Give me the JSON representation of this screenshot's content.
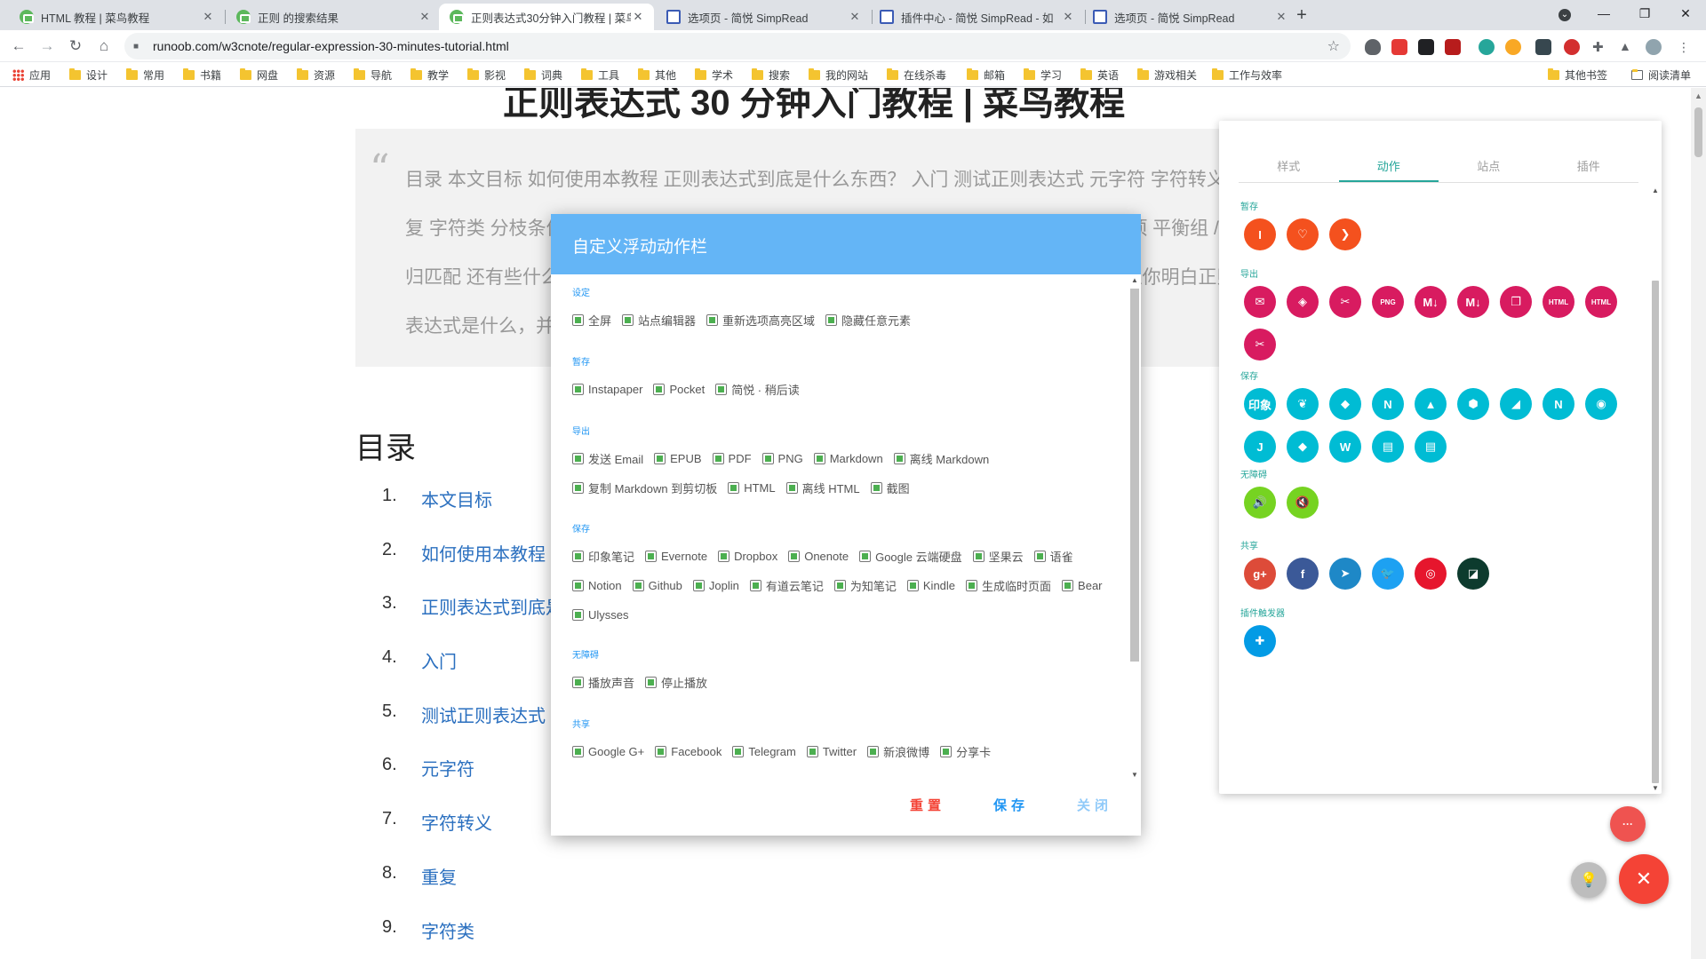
{
  "browser": {
    "tabs": [
      {
        "title": "HTML 教程 | 菜鸟教程",
        "favicon": "runoob-icon"
      },
      {
        "title": "正则 的搜索结果",
        "favicon": "runoob-icon"
      },
      {
        "title": "正则表达式30分钟入门教程 | 菜鸟",
        "favicon": "runoob-icon",
        "active": true
      },
      {
        "title": "选项页 - 简悦 SimpRead",
        "favicon": "simpread-icon"
      },
      {
        "title": "插件中心 - 简悦 SimpRead - 如",
        "favicon": "simpread-icon"
      },
      {
        "title": "选项页 - 简悦 SimpRead",
        "favicon": "simpread-icon"
      }
    ],
    "tab_close": "✕",
    "new_tab": "+",
    "window_controls": {
      "menu": "⌄",
      "minimize": "—",
      "restore": "❐",
      "close": "✕"
    },
    "url": "runoob.com/w3cnote/regular-expression-30-minutes-tutorial.html",
    "nav": {
      "back": "←",
      "forward": "→",
      "reload": "↻",
      "home": "⌂"
    },
    "bookmarks_left": [
      "应用",
      "设计",
      "常用",
      "书籍",
      "网盘",
      "资源",
      "导航",
      "教学",
      "影视",
      "词典",
      "工具",
      "其他",
      "学术",
      "搜索",
      "我的网站",
      "在线杀毒",
      "邮箱",
      "学习",
      "英语",
      "游戏相关",
      "工作与效率"
    ],
    "bookmarks_right": [
      "其他书签",
      "阅读清单"
    ]
  },
  "page": {
    "title": "正则表达式 30 分钟入门教程 | 菜鸟教程",
    "quote_mark": "“",
    "quote_text": "目录 本文目标 如何使用本教程 正则表达式到底是什么东西？ 入门 测试正则表达式 元字符 字符转义 重复 字符类 分枝条件 反义 分组 后向引用 零宽断言 负向零宽断言 注释 贪婪与懒惰 处理选项 平衡组 / 递归匹配 还有些什么东西没提到 联系作者 网上的资源及本文参考文献 本文目标 30分钟内让你明白正则表达式是什么，并对它有一些基本的了解，",
    "toc_title": "目录",
    "toc": [
      {
        "num": "1.",
        "label": "本文目标"
      },
      {
        "num": "2.",
        "label": "如何使用本教程"
      },
      {
        "num": "3.",
        "label": "正则表达式到底是什么东西？"
      },
      {
        "num": "4.",
        "label": "入门"
      },
      {
        "num": "5.",
        "label": "测试正则表达式"
      },
      {
        "num": "6.",
        "label": "元字符"
      },
      {
        "num": "7.",
        "label": "字符转义"
      },
      {
        "num": "8.",
        "label": "重复"
      },
      {
        "num": "9.",
        "label": "字符类"
      }
    ]
  },
  "panel": {
    "tabs": [
      "样式",
      "动作",
      "站点",
      "插件"
    ],
    "active_tab": "动作",
    "accent": "#26a69a",
    "sections": {
      "save_later": {
        "title": "暂存",
        "icons": [
          {
            "name": "instapaper-icon",
            "label": "I",
            "color": "#f4511e"
          },
          {
            "name": "pocket-icon",
            "label": "♡",
            "color": "#f4511e"
          },
          {
            "name": "simpread-later-icon",
            "label": "❯",
            "color": "#f4511e"
          }
        ]
      },
      "export": {
        "title": "导出",
        "icons": [
          {
            "name": "email-icon",
            "label": "✉",
            "color": "#d81b60"
          },
          {
            "name": "epub-icon",
            "label": "◈",
            "color": "#d81b60"
          },
          {
            "name": "pdf-icon",
            "label": "✂",
            "color": "#d81b60"
          },
          {
            "name": "png-icon",
            "label": "PNG",
            "color": "#d81b60"
          },
          {
            "name": "markdown-icon",
            "label": "M↓",
            "color": "#d81b60"
          },
          {
            "name": "offline-markdown-icon",
            "label": "M↓",
            "color": "#d81b60"
          },
          {
            "name": "copy-markdown-icon",
            "label": "❐",
            "color": "#d81b60"
          },
          {
            "name": "html-icon",
            "label": "HTML",
            "color": "#d81b60"
          },
          {
            "name": "offline-html-icon",
            "label": "HTML",
            "color": "#d81b60"
          },
          {
            "name": "screenshot-icon",
            "label": "✂",
            "color": "#d81b60"
          }
        ]
      },
      "save": {
        "title": "保存",
        "icons": [
          {
            "name": "yinxiang-icon",
            "label": "印象",
            "color": "#00bcd4"
          },
          {
            "name": "evernote-icon",
            "label": "❦",
            "color": "#00bcd4"
          },
          {
            "name": "dropbox-icon",
            "label": "◆",
            "color": "#00bcd4"
          },
          {
            "name": "onenote-icon",
            "label": "N",
            "color": "#00bcd4"
          },
          {
            "name": "google-drive-icon",
            "label": "▲",
            "color": "#00bcd4"
          },
          {
            "name": "jianguoyun-icon",
            "label": "⬢",
            "color": "#00bcd4"
          },
          {
            "name": "yuque-icon",
            "label": "◢",
            "color": "#00bcd4"
          },
          {
            "name": "notion-icon",
            "label": "N",
            "color": "#00bcd4"
          },
          {
            "name": "github-icon",
            "label": "◉",
            "color": "#00bcd4"
          },
          {
            "name": "joplin-icon",
            "label": "J",
            "color": "#00bcd4"
          },
          {
            "name": "youdao-icon",
            "label": "◆",
            "color": "#00bcd4"
          },
          {
            "name": "wiznote-icon",
            "label": "W",
            "color": "#00bcd4"
          },
          {
            "name": "kindle-icon",
            "label": "▤",
            "color": "#00bcd4"
          },
          {
            "name": "temp-page-icon",
            "label": "▤",
            "color": "#00bcd4"
          }
        ]
      },
      "accessibility": {
        "title": "无障碍",
        "icons": [
          {
            "name": "speaker-on-icon",
            "label": "🔊",
            "color": "#76d321"
          },
          {
            "name": "speaker-off-icon",
            "label": "🔇",
            "color": "#76d321"
          }
        ]
      },
      "share": {
        "title": "共享",
        "icons": [
          {
            "name": "google-plus-icon",
            "label": "g+",
            "color": "#dd4b39"
          },
          {
            "name": "facebook-icon",
            "label": "f",
            "color": "#3b5998"
          },
          {
            "name": "telegram-icon",
            "label": "➤",
            "color": "#1e88c7"
          },
          {
            "name": "twitter-icon",
            "label": "🐦",
            "color": "#1da1f2"
          },
          {
            "name": "weibo-icon",
            "label": "◎",
            "color": "#e6162d"
          },
          {
            "name": "share-card-icon",
            "label": "◪",
            "color": "#0d3b2e"
          }
        ]
      },
      "plugin_trigger": {
        "title": "插件触发器",
        "icons": [
          {
            "name": "plugin-icon",
            "label": "✚",
            "color": "#039be5"
          }
        ]
      }
    }
  },
  "modal": {
    "title": "自定义浮动动作栏",
    "groups": [
      {
        "title": "设定",
        "items": [
          "全屏",
          "站点编辑器",
          "重新选项高亮区域",
          "隐藏任意元素"
        ]
      },
      {
        "title": "暂存",
        "items": [
          "Instapaper",
          "Pocket",
          "简悦 · 稍后读"
        ]
      },
      {
        "title": "导出",
        "items": [
          "发送 Email",
          "EPUB",
          "PDF",
          "PNG",
          "Markdown",
          "离线 Markdown",
          "复制 Markdown 到剪切板",
          "HTML",
          "离线 HTML",
          "截图"
        ]
      },
      {
        "title": "保存",
        "items": [
          "印象笔记",
          "Evernote",
          "Dropbox",
          "Onenote",
          "Google 云端硬盘",
          "坚果云",
          "语雀",
          "Notion",
          "Github",
          "Joplin",
          "有道云笔记",
          "为知笔记",
          "Kindle",
          "生成临时页面",
          "Bear",
          "Ulysses"
        ]
      },
      {
        "title": "无障碍",
        "items": [
          "播放声音",
          "停止播放"
        ]
      },
      {
        "title": "共享",
        "items": [
          "Google G+",
          "Facebook",
          "Telegram",
          "Twitter",
          "新浪微博",
          "分享卡"
        ]
      }
    ],
    "buttons": {
      "reset": "重置",
      "save": "保存",
      "close": "关闭"
    },
    "colors": {
      "header": "#64b5f6",
      "reset": "#f44336",
      "save": "#2196f3",
      "close": "#90caf9",
      "check": "#4caf50"
    }
  },
  "fabs": {
    "more": "···",
    "lamp": "💡",
    "close": "✕"
  }
}
